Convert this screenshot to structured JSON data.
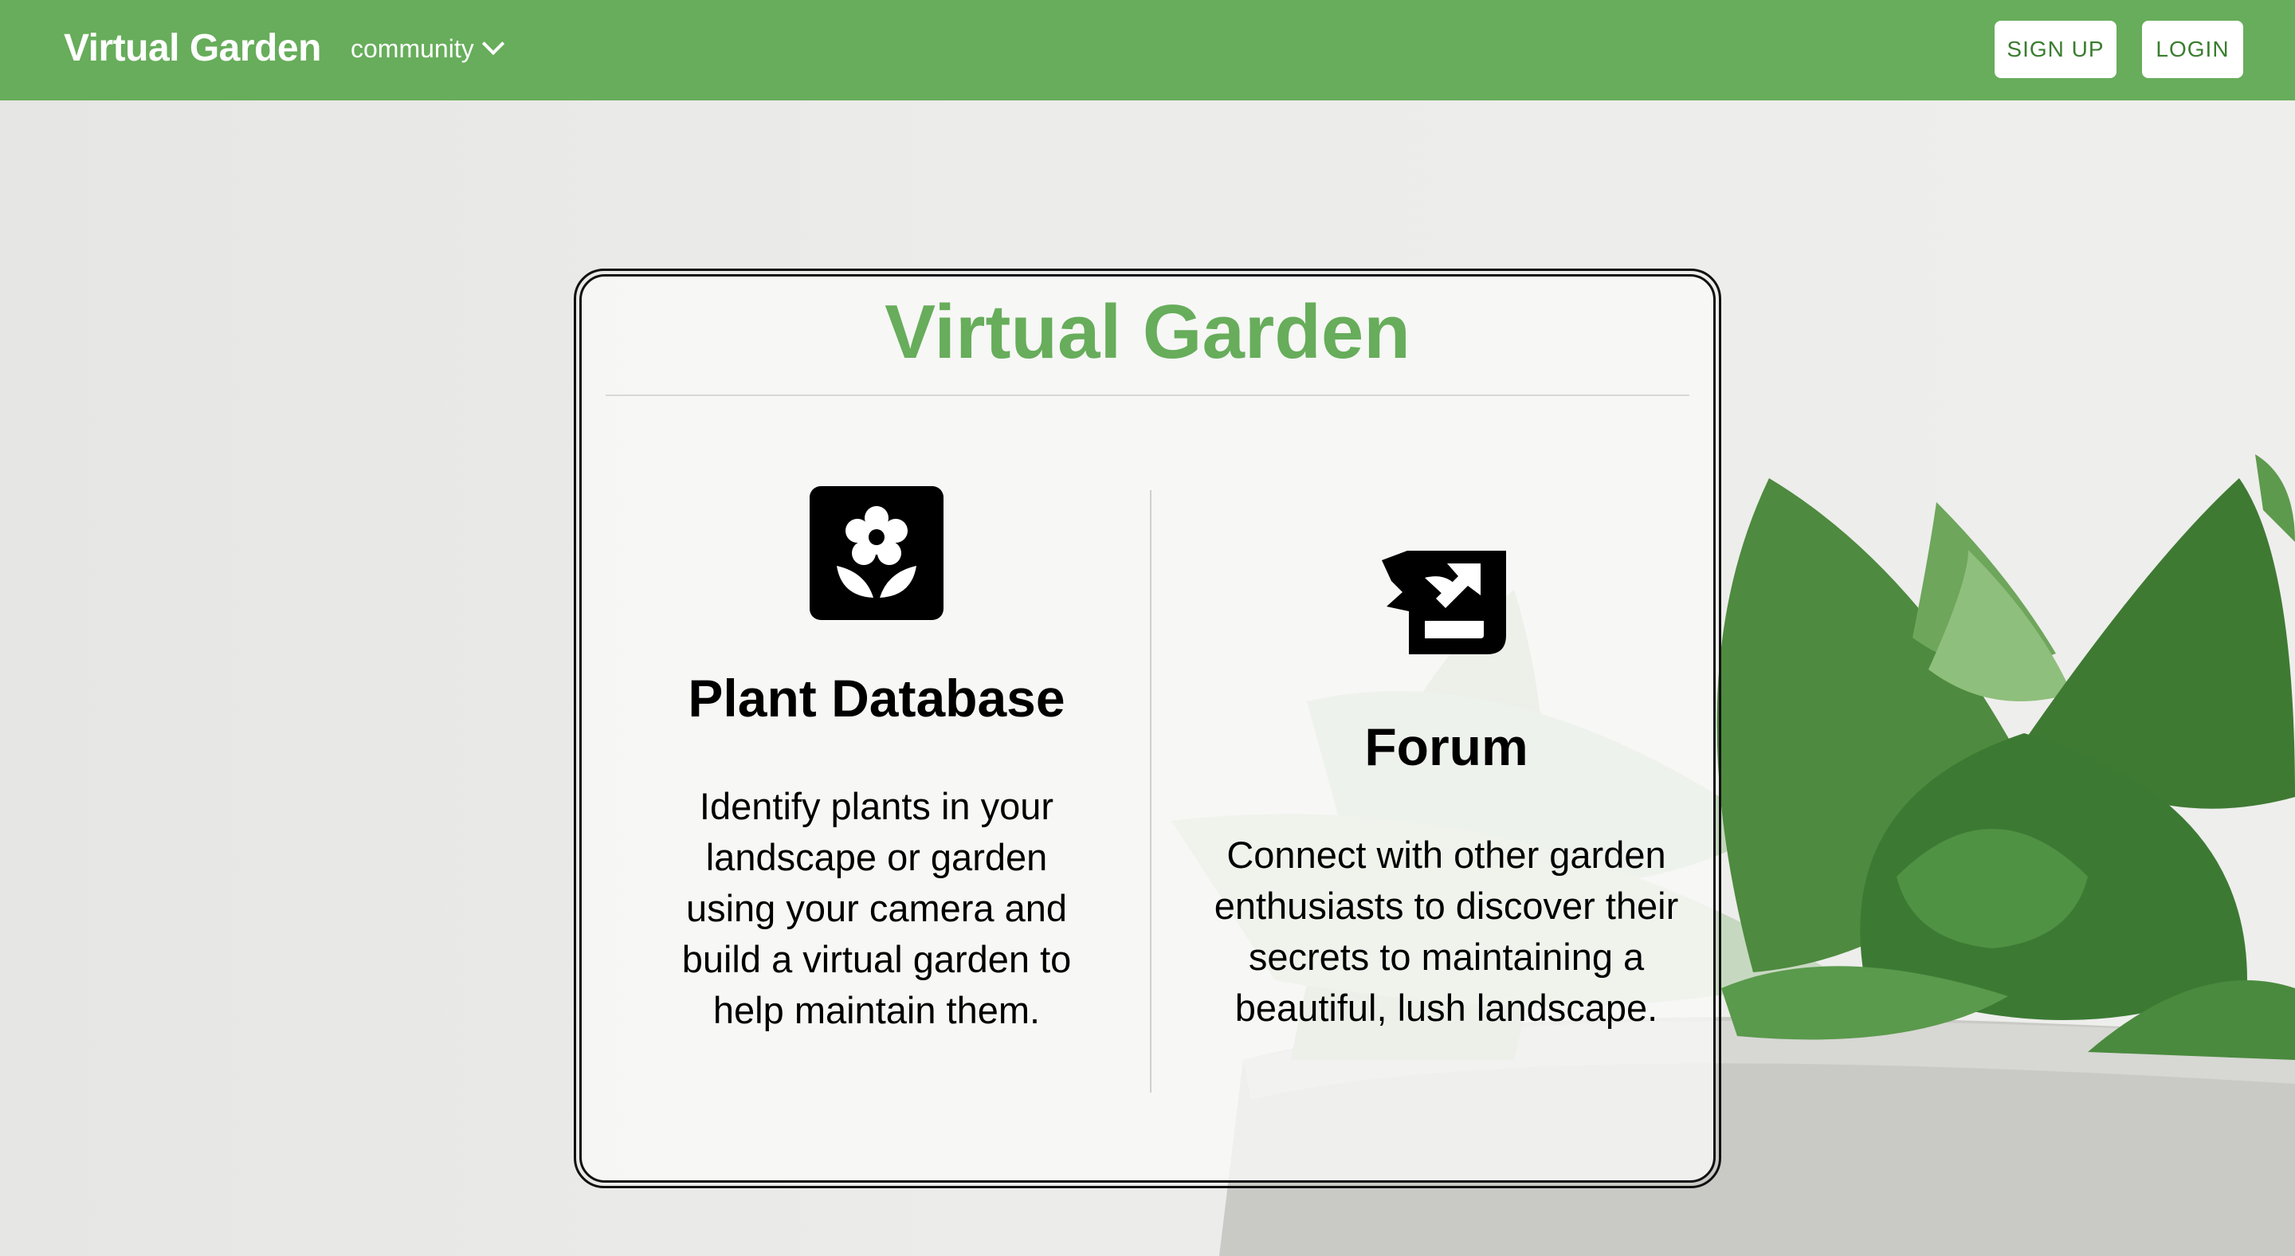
{
  "navbar": {
    "brand": "Virtual Garden",
    "community_label": "community",
    "signup_label": "SIGN UP",
    "login_label": "LOGIN"
  },
  "card": {
    "title": "Virtual Garden",
    "features": [
      {
        "icon": "flower-icon",
        "heading": "Plant Database",
        "text": "Identify plants in your landscape or garden using your camera and build a virtual garden to help maintain them."
      },
      {
        "icon": "forum-icon",
        "heading": "Forum",
        "text": "Connect with other garden enthusiasts to discover their secrets to maintaining a beautiful, lush landscape."
      }
    ]
  },
  "colors": {
    "brand_green": "#67ad5b",
    "button_text_green": "#3a7d2f"
  }
}
